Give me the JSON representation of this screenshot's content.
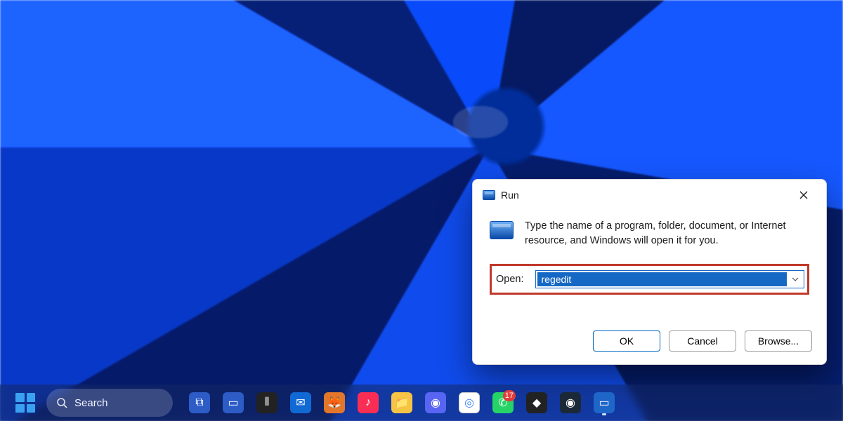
{
  "run_dialog": {
    "title": "Run",
    "description": "Type the name of a program, folder, document, or Internet resource, and Windows will open it for you.",
    "open_label": "Open:",
    "open_value": "regedit",
    "buttons": {
      "ok": "OK",
      "cancel": "Cancel",
      "browse": "Browse..."
    }
  },
  "taskbar": {
    "search_placeholder": "Search",
    "whatsapp_badge": "17",
    "items": [
      {
        "name": "task-view",
        "bg": "#2d5cc7",
        "glyph": "⧉"
      },
      {
        "name": "desktops",
        "bg": "#2d5cc7",
        "glyph": "▭"
      },
      {
        "name": "rainmeter",
        "bg": "#222",
        "glyph": "⫴"
      },
      {
        "name": "thunderbird",
        "bg": "#1169d4",
        "glyph": "✉"
      },
      {
        "name": "firefox",
        "bg": "#e2762a",
        "glyph": "🦊"
      },
      {
        "name": "apple-music",
        "bg": "#fa2e54",
        "glyph": "♪"
      },
      {
        "name": "file-explorer",
        "bg": "#f6c445",
        "glyph": "📁"
      },
      {
        "name": "discord",
        "bg": "#5865f2",
        "glyph": "◉"
      },
      {
        "name": "chrome",
        "bg": "#ffffff",
        "glyph": "◎"
      },
      {
        "name": "whatsapp",
        "bg": "#25d366",
        "glyph": "✆"
      },
      {
        "name": "epic-games",
        "bg": "#222",
        "glyph": "◆"
      },
      {
        "name": "steam",
        "bg": "#1b2838",
        "glyph": "◉"
      },
      {
        "name": "run-pinned",
        "bg": "#1f66c9",
        "glyph": "▭"
      }
    ]
  }
}
